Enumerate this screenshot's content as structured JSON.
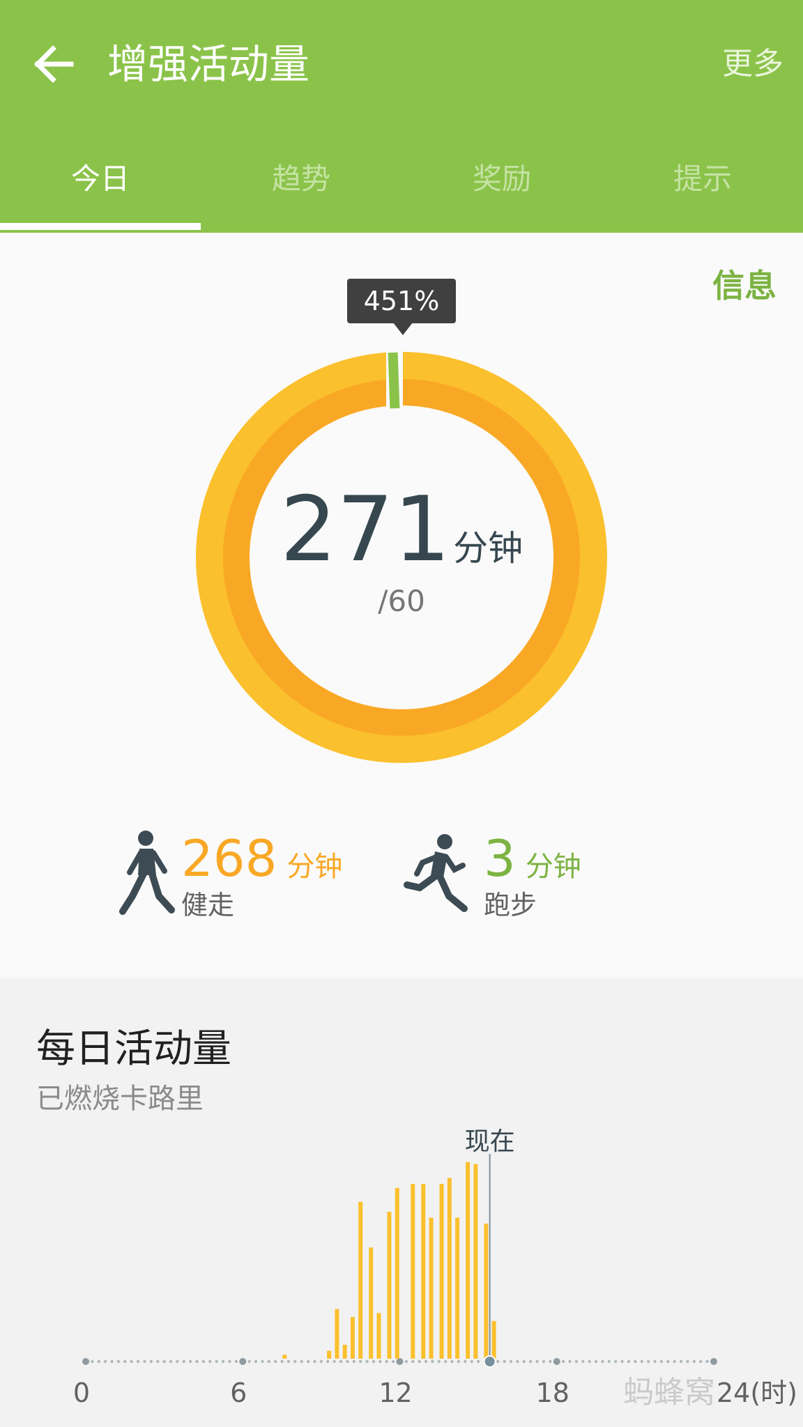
{
  "header": {
    "title": "增强活动量",
    "back_icon": "arrow-left-icon",
    "more_label": "更多",
    "color": "#8bc34a"
  },
  "tabs": [
    {
      "label": "今日",
      "active": true
    },
    {
      "label": "趋势",
      "active": false
    },
    {
      "label": "奖励",
      "active": false
    },
    {
      "label": "提示",
      "active": false
    }
  ],
  "info_label": "信息",
  "progress": {
    "percent_label": "451%",
    "value": "271",
    "unit": "分钟",
    "goal": "/60",
    "percent": 451,
    "ring_color_outer": "#fbc02d",
    "ring_color_inner": "#f9a825",
    "goal_marker_color": "#8bc34a"
  },
  "stats": [
    {
      "value": "268",
      "unit": "分钟",
      "label": "健走",
      "icon": "walking-person-icon",
      "color": "#f9a825"
    },
    {
      "value": "3",
      "unit": "分钟",
      "label": "跑步",
      "icon": "running-person-icon",
      "color": "#7cb342"
    }
  ],
  "daily": {
    "title": "每日活动量",
    "subtitle": "已燃烧卡路里",
    "now_label": "现在"
  },
  "chart_data": {
    "type": "bar",
    "x_ticks": [
      "0",
      "6",
      "12",
      "18",
      "24(时)"
    ],
    "xlim": [
      0,
      24
    ],
    "ylim": [
      0,
      1
    ],
    "now_hour": 15.6,
    "bar_color": "#fbc02d",
    "bars": [
      {
        "x": 7.6,
        "y": 0.02
      },
      {
        "x": 9.3,
        "y": 0.04
      },
      {
        "x": 9.6,
        "y": 0.25
      },
      {
        "x": 9.9,
        "y": 0.07
      },
      {
        "x": 10.2,
        "y": 0.21
      },
      {
        "x": 10.5,
        "y": 0.79
      },
      {
        "x": 10.9,
        "y": 0.56
      },
      {
        "x": 11.2,
        "y": 0.23
      },
      {
        "x": 11.6,
        "y": 0.74
      },
      {
        "x": 11.9,
        "y": 0.86
      },
      {
        "x": 12.5,
        "y": 0.88
      },
      {
        "x": 12.9,
        "y": 0.88
      },
      {
        "x": 13.2,
        "y": 0.71
      },
      {
        "x": 13.6,
        "y": 0.88
      },
      {
        "x": 13.9,
        "y": 0.91
      },
      {
        "x": 14.2,
        "y": 0.71
      },
      {
        "x": 14.6,
        "y": 0.99
      },
      {
        "x": 14.9,
        "y": 0.98
      },
      {
        "x": 15.3,
        "y": 0.68
      },
      {
        "x": 15.6,
        "y": 0.19
      }
    ]
  },
  "watermark": "蚂蜂窝"
}
